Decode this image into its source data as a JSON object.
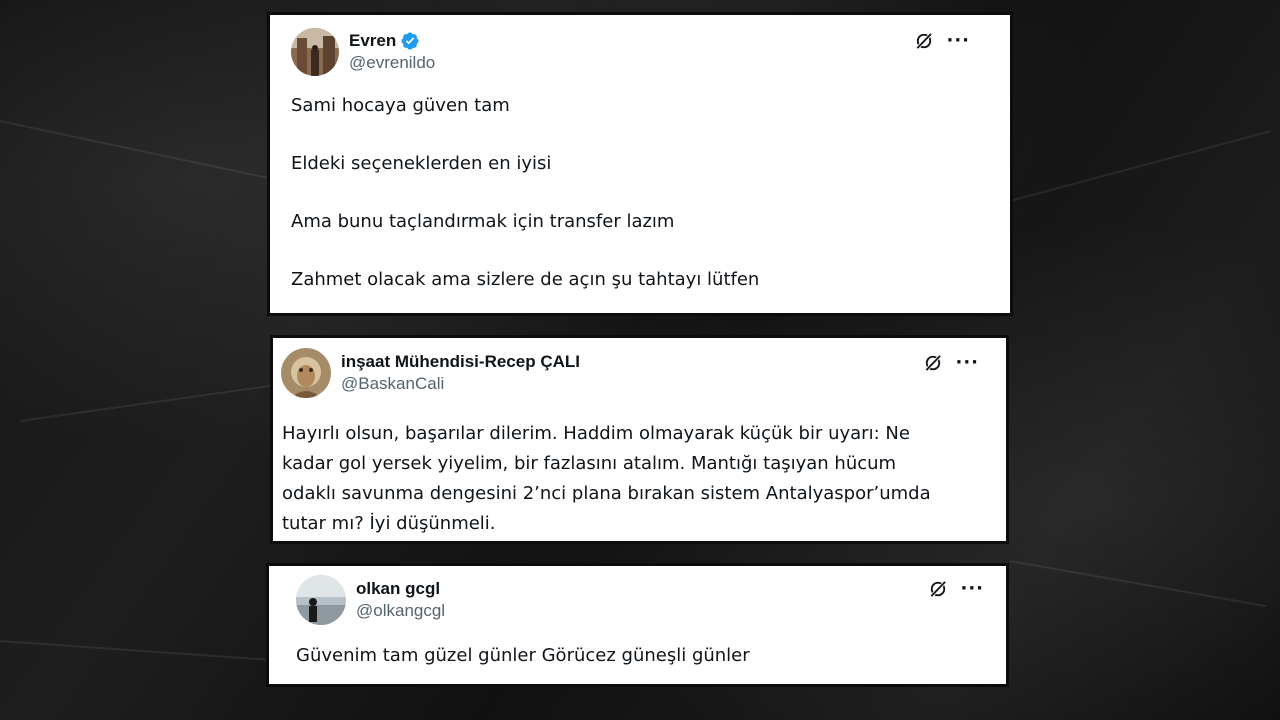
{
  "tweets": [
    {
      "display_name": "Evren",
      "handle": "@evrenildo",
      "verified": true,
      "more_label": "···",
      "paragraphs": [
        "Sami hocaya güven tam",
        "Eldeki seçeneklerden en iyisi",
        "Ama bunu taçlandırmak için transfer lazım",
        "Zahmet olacak ama sizlere de açın şu tahtayı lütfen"
      ]
    },
    {
      "display_name": "inşaat Mühendisi-Recep ÇALI",
      "handle": "@BaskanCali",
      "verified": false,
      "more_label": "···",
      "lines": [
        "Hayırlı olsun, başarılar dilerim. Haddim olmayarak küçük bir uyarı: Ne",
        "kadar gol yersek yiyelim, bir fazlasını atalım. Mantığı taşıyan hücum",
        "odaklı savunma dengesini 2’nci plana bırakan sistem Antalyaspor’umda",
        "tutar mı? İyi düşünmeli."
      ]
    },
    {
      "display_name": "olkan gcgl",
      "handle": "@olkangcgl",
      "verified": false,
      "more_label": "···",
      "paragraphs": [
        "Güvenim tam güzel günler Görücez güneşli günler"
      ]
    }
  ],
  "colors": {
    "verified_badge": "#1d9bf0",
    "handle_gray": "#536471",
    "text": "#0f1419"
  },
  "icons": {
    "verified": "verified-badge-icon",
    "grok": "grok-icon",
    "more": "more-options-icon"
  }
}
